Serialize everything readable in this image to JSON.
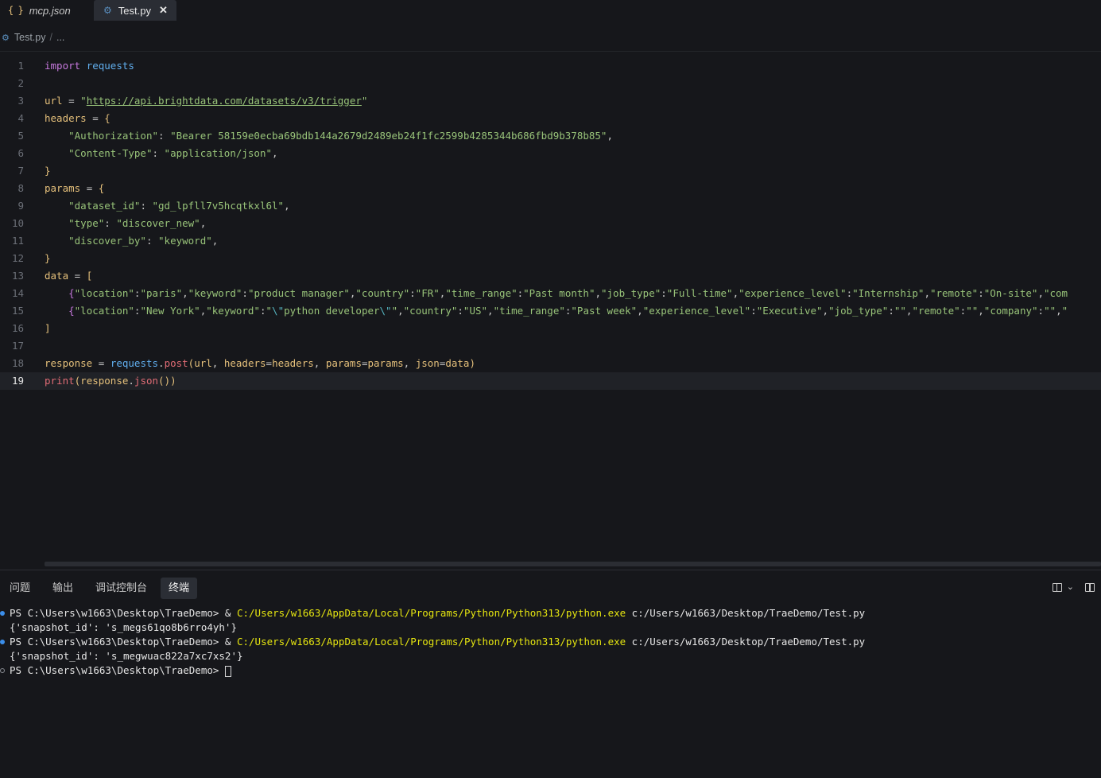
{
  "tabs": [
    {
      "icon": "{ }",
      "label": "mcp.json"
    },
    {
      "icon": "python-file-icon",
      "label": "Test.py",
      "close": "✕"
    }
  ],
  "breadcrumb": {
    "file": "Test.py",
    "separator": "/",
    "more": "..."
  },
  "editor": {
    "line_numbers": [
      "1",
      "2",
      "3",
      "4",
      "5",
      "6",
      "7",
      "8",
      "9",
      "10",
      "11",
      "12",
      "13",
      "14",
      "15",
      "16",
      "17",
      "18",
      "19"
    ],
    "current_line": "19",
    "lines": [
      "import requests",
      "",
      "url = \"https://api.brightdata.com/datasets/v3/trigger\"",
      "headers = {",
      "    \"Authorization\": \"Bearer 58159e0ecba69bdb144a2679d2489eb24f1fc2599b4285344b686fbd9b378b85\",",
      "    \"Content-Type\": \"application/json\",",
      "}",
      "params = {",
      "    \"dataset_id\": \"gd_lpfll7v5hcqtkxl6l\",",
      "    \"type\": \"discover_new\",",
      "    \"discover_by\": \"keyword\",",
      "}",
      "data = [",
      "    {\"location\":\"paris\",\"keyword\":\"product manager\",\"country\":\"FR\",\"time_range\":\"Past month\",\"job_type\":\"Full-time\",\"experience_level\":\"Internship\",\"remote\":\"On-site\",\"com",
      "    {\"location\":\"New York\",\"keyword\":\"\\\"python developer\\\"\",\"country\":\"US\",\"time_range\":\"Past week\",\"experience_level\":\"Executive\",\"job_type\":\"\",\"remote\":\"\",\"company\":\"\",\"",
      "]",
      "",
      "response = requests.post(url, headers=headers, params=params, json=data)",
      "print(response.json())"
    ]
  },
  "panel": {
    "tabs": [
      "问题",
      "输出",
      "调试控制台",
      "终端"
    ],
    "active_tab": "终端"
  },
  "terminal": {
    "lines": [
      {
        "prompt": "PS C:\\Users\\w1663\\Desktop\\TraeDemo> & ",
        "exe": "C:/Users/w1663/AppData/Local/Programs/Python/Python313/python.exe",
        "arg": " c:/Users/w1663/Desktop/TraeDemo/Test.py"
      },
      {
        "output": "{'snapshot_id': 's_megs61qo8b6rro4yh'}"
      },
      {
        "prompt": "PS C:\\Users\\w1663\\Desktop\\TraeDemo> & ",
        "exe": "C:/Users/w1663/AppData/Local/Programs/Python/Python313/python.exe",
        "arg": " c:/Users/w1663/Desktop/TraeDemo/Test.py"
      },
      {
        "output": "{'snapshot_id': 's_megwuac822a7xc7xs2'}"
      },
      {
        "prompt": "PS C:\\Users\\w1663\\Desktop\\TraeDemo> "
      }
    ]
  },
  "colors": {
    "background": "#16171b",
    "keyword": "#c678dd",
    "string": "#98c379",
    "variable": "#e5c07b",
    "module": "#61afef",
    "terminal_exe": "#e5e510",
    "status_dot": "#3b8eea"
  }
}
